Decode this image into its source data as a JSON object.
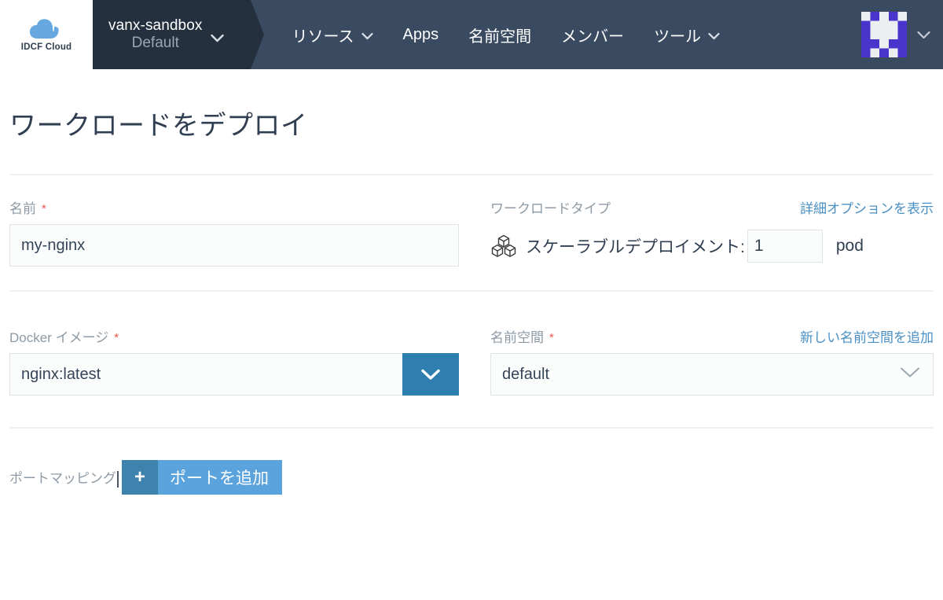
{
  "brand": {
    "logo_text": "IDCF Cloud",
    "logo_icon": "cloud-icon",
    "cloud_color": "#68a8e0"
  },
  "navbar": {
    "background": "#3a4a61",
    "project": {
      "name": "vanx-sandbox",
      "environment": "Default",
      "caret_icon": "chevron-down-icon",
      "background": "#25303f"
    },
    "items": [
      {
        "label": "リソース",
        "has_caret": true,
        "caret_icon": "chevron-down-icon"
      },
      {
        "label": "Apps",
        "has_caret": false,
        "caret_icon": ""
      },
      {
        "label": "名前空間",
        "has_caret": false,
        "caret_icon": ""
      },
      {
        "label": "メンバー",
        "has_caret": false,
        "caret_icon": ""
      },
      {
        "label": "ツール",
        "has_caret": true,
        "caret_icon": "chevron-down-icon"
      }
    ],
    "account": {
      "avatar_icon": "identicon-avatar",
      "avatar_color": "#4a34cc",
      "caret_icon": "chevron-down-icon"
    }
  },
  "page": {
    "title": "ワークロードをデプロイ"
  },
  "form": {
    "name_field": {
      "label": "名前",
      "required_marker": "*",
      "value": "my-nginx",
      "placeholder": ""
    },
    "workload_type": {
      "label": "ワークロードタイプ",
      "icon": "cubes-icon",
      "type_label": "スケーラブルデプロイメント:",
      "replicas": "1",
      "unit": "pod",
      "advanced_link": "詳細オプションを表示"
    },
    "docker_image": {
      "label": "Docker イメージ",
      "required_marker": "*",
      "value": "nginx:latest",
      "dropdown_icon": "chevron-down-icon",
      "dropdown_color": "#2f7eb0"
    },
    "namespace": {
      "label": "名前空間",
      "required_marker": "*",
      "value": "default",
      "dropdown_icon": "chevron-down-icon",
      "add_link": "新しい名前空間を追加"
    },
    "port_mapping": {
      "label": "ポートマッピング",
      "add_button_label": "ポートを追加",
      "add_button_icon": "plus-icon",
      "add_button_color": "#5ba3dd"
    }
  }
}
